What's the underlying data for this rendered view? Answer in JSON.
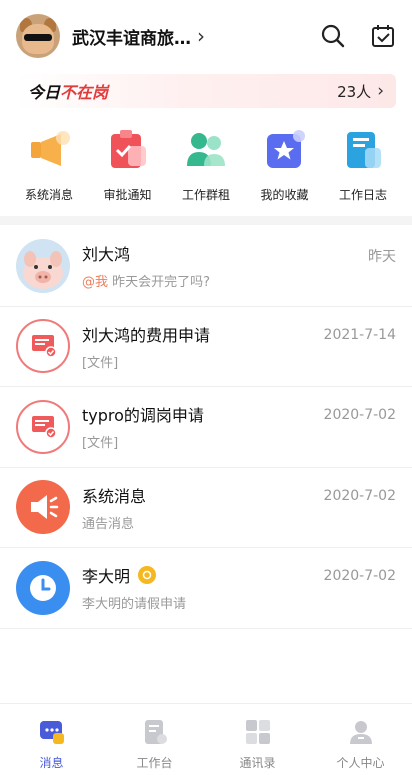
{
  "header": {
    "org_name": "武汉丰谊商旅…",
    "icons": {
      "search": "search-icon",
      "calendar": "calendar-check-icon",
      "chevron": "chevron-right-icon"
    }
  },
  "banner": {
    "title_prefix": "今日",
    "title_highlight": "不在岗",
    "count": "23人"
  },
  "quick": [
    {
      "label": "系统消息",
      "icon": "megaphone-icon"
    },
    {
      "label": "审批通知",
      "icon": "clipboard-check-icon"
    },
    {
      "label": "工作群租",
      "icon": "group-icon"
    },
    {
      "label": "我的收藏",
      "icon": "star-icon"
    },
    {
      "label": "工作日志",
      "icon": "notebook-icon"
    }
  ],
  "messages": [
    {
      "title": "刘大鸿",
      "mention": "@我",
      "subtitle": "昨天会开完了吗?",
      "time": "昨天"
    },
    {
      "title": "刘大鸿的费用申请",
      "subtitle": "[文件]",
      "time": "2021-7-14"
    },
    {
      "title": "typro的调岗申请",
      "subtitle": "[文件]",
      "time": "2020-7-02"
    },
    {
      "title": "系统消息",
      "subtitle": "通告消息",
      "time": "2020-7-02"
    },
    {
      "title": "李大明",
      "subtitle": "李大明的请假申请",
      "time": "2020-7-02"
    }
  ],
  "tabs": [
    {
      "label": "消息",
      "active": true
    },
    {
      "label": "工作台",
      "active": false
    },
    {
      "label": "通讯录",
      "active": false
    },
    {
      "label": "个人中心",
      "active": false
    }
  ],
  "colors": {
    "accent": "#4a5bd9",
    "red": "#e23b3b",
    "orange": "#f26a4b",
    "blue": "#3a8ef0"
  }
}
